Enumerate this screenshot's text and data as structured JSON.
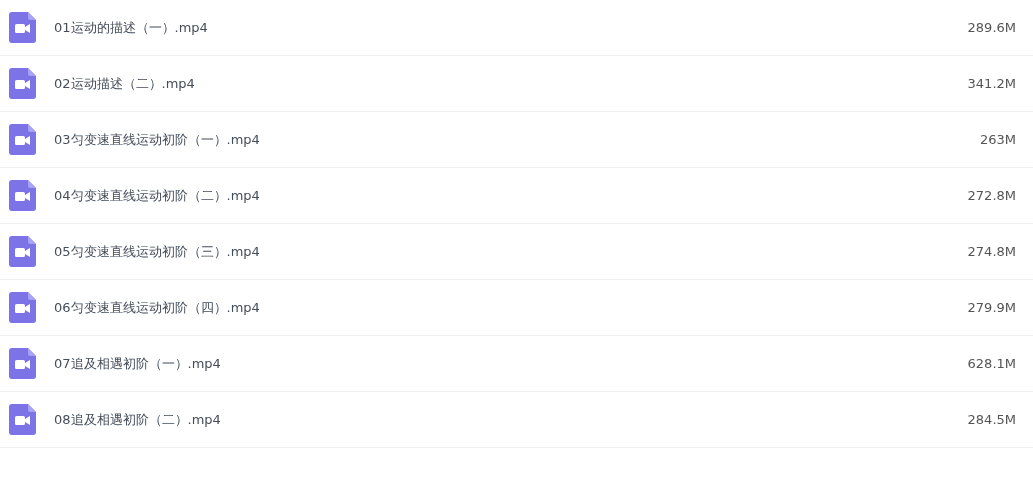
{
  "files": [
    {
      "name": "01运动的描述（一）.mp4",
      "size": "289.6M"
    },
    {
      "name": "02运动描述（二）.mp4",
      "size": "341.2M"
    },
    {
      "name": "03匀变速直线运动初阶（一）.mp4",
      "size": "263M"
    },
    {
      "name": "04匀变速直线运动初阶（二）.mp4",
      "size": "272.8M"
    },
    {
      "name": "05匀变速直线运动初阶（三）.mp4",
      "size": "274.8M"
    },
    {
      "name": "06匀变速直线运动初阶（四）.mp4",
      "size": "279.9M"
    },
    {
      "name": "07追及相遇初阶（一）.mp4",
      "size": "628.1M"
    },
    {
      "name": "08追及相遇初阶（二）.mp4",
      "size": "284.5M"
    }
  ]
}
